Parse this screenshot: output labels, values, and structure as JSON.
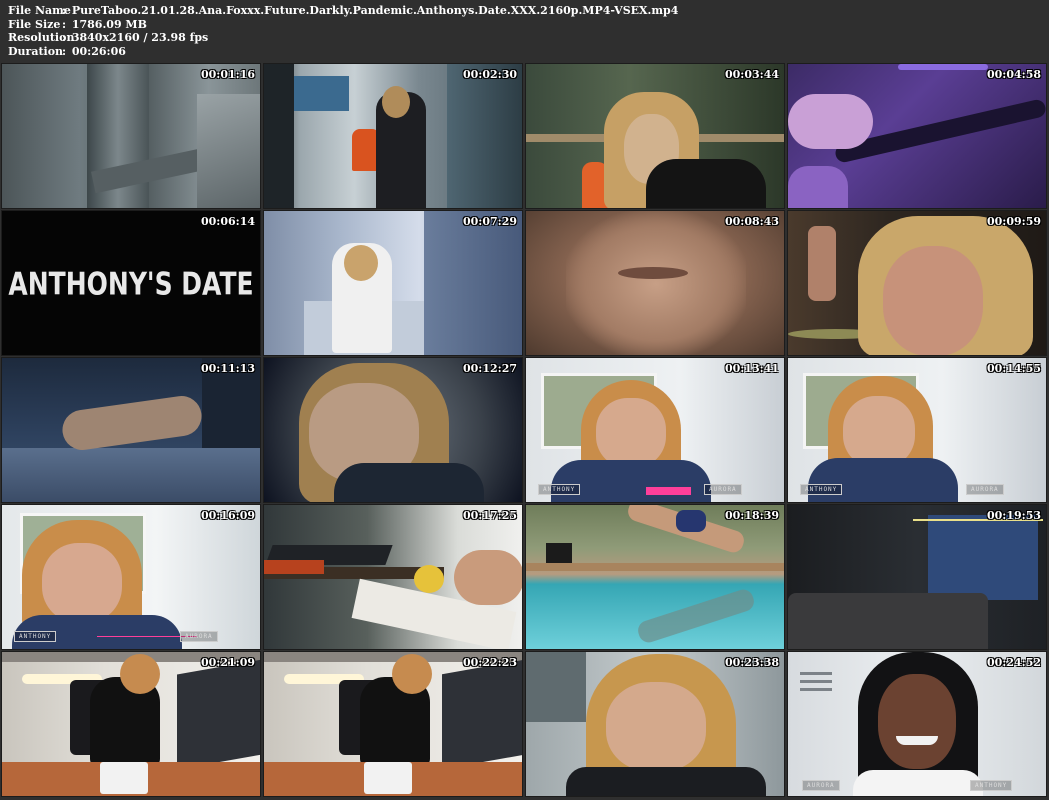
{
  "file_info": {
    "file_name_label": "File Name",
    "file_name_value": "PureTaboo.21.01.28.Ana.Foxxx.Future.Darkly.Pandemic.Anthonys.Date.XXX.2160p.MP4-VSEX.mp4",
    "file_size_label": "File Size",
    "file_size_value": "1786.09 MB",
    "resolution_label": "Resolution",
    "resolution_value": "3840x2160 / 23.98 fps",
    "duration_label": "Duration",
    "duration_value": "00:26:06",
    "separator": ":"
  },
  "thumbnails": [
    {
      "timestamp": "00:01:16"
    },
    {
      "timestamp": "00:02:30"
    },
    {
      "timestamp": "00:03:44"
    },
    {
      "timestamp": "00:04:58"
    },
    {
      "timestamp": "00:06:14",
      "title_text": "ANTHONY'S DATE"
    },
    {
      "timestamp": "00:07:29"
    },
    {
      "timestamp": "00:08:43"
    },
    {
      "timestamp": "00:09:59"
    },
    {
      "timestamp": "00:11:13"
    },
    {
      "timestamp": "00:12:27"
    },
    {
      "timestamp": "00:13:41",
      "hud_left": "ANTHONY",
      "hud_right": "AURORA"
    },
    {
      "timestamp": "00:14:55",
      "hud_left": "ANTHONY",
      "hud_right": "AURORA"
    },
    {
      "timestamp": "00:16:09",
      "hud_left": "ANTHONY",
      "hud_right": "AURORA"
    },
    {
      "timestamp": "00:17:25"
    },
    {
      "timestamp": "00:18:39"
    },
    {
      "timestamp": "00:19:53"
    },
    {
      "timestamp": "00:21:09"
    },
    {
      "timestamp": "00:22:23"
    },
    {
      "timestamp": "00:23:38"
    },
    {
      "timestamp": "00:24:52",
      "hud_left": "AURORA",
      "hud_right": "ANTHONY"
    }
  ]
}
